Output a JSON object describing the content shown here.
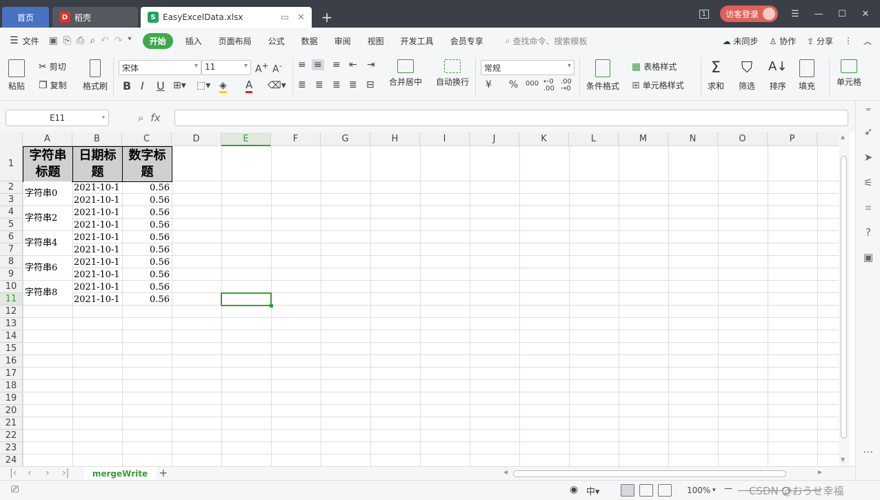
{
  "tabs": {
    "home": "首页",
    "daoke": "稻壳",
    "file": "EasyExcelData.xlsx",
    "daoke_logo": "D",
    "file_logo": "S"
  },
  "window": {
    "login": "访客登录",
    "page_badge": "1"
  },
  "menu": {
    "file": "文件",
    "start": "开始",
    "items": [
      "插入",
      "页面布局",
      "公式",
      "数据",
      "审阅",
      "视图",
      "开发工具",
      "会员专享"
    ],
    "search": "查找命令、搜索模板",
    "sync": "未同步",
    "collab": "协作",
    "share": "分享"
  },
  "ribbon": {
    "paste": "粘贴",
    "cut": "剪切",
    "copy": "复制",
    "format_painter": "格式刷",
    "font_name": "宋体",
    "font_size": "11",
    "merge_center": "合并居中",
    "wrap_text": "自动换行",
    "number_format": "常规",
    "currency": "¥",
    "percent": "%",
    "thousands": "000",
    "conditional_format": "条件格式",
    "table_style": "表格样式",
    "cell_style": "单元格样式",
    "sum": "求和",
    "filter": "筛选",
    "sort": "排序",
    "fill": "填充",
    "cell": "单元格"
  },
  "formula_bar": {
    "name_box": "E11",
    "fx": "fx",
    "formula": ""
  },
  "sheet": {
    "columns": [
      "A",
      "B",
      "C",
      "D",
      "E",
      "F",
      "G",
      "H",
      "I",
      "J",
      "K",
      "L",
      "M",
      "N",
      "O",
      "P"
    ],
    "selected_column": "E",
    "selected_row": "11",
    "rows": [
      "1",
      "2",
      "3",
      "4",
      "5",
      "6",
      "7",
      "8",
      "9",
      "10",
      "11",
      "12",
      "13",
      "14",
      "15",
      "16",
      "17",
      "18",
      "19",
      "20",
      "21",
      "22",
      "23",
      "24"
    ],
    "headers": [
      "字符串标题",
      "日期标题",
      "数字标题"
    ],
    "merged_strings": [
      "字符串0",
      "字符串2",
      "字符串4",
      "字符串6",
      "字符串8"
    ],
    "dates": [
      "2021-10-1",
      "2021-10-1",
      "2021-10-1",
      "2021-10-1",
      "2021-10-1",
      "2021-10-1",
      "2021-10-1",
      "2021-10-1",
      "2021-10-1",
      "2021-10-1"
    ],
    "numbers": [
      "0.56",
      "0.56",
      "0.56",
      "0.56",
      "0.56",
      "0.56",
      "0.56",
      "0.56",
      "0.56",
      "0.56"
    ],
    "tab_name": "mergeWrite"
  },
  "status": {
    "zoom": "100%",
    "watermark": "CSDN @おうせ幸福"
  }
}
